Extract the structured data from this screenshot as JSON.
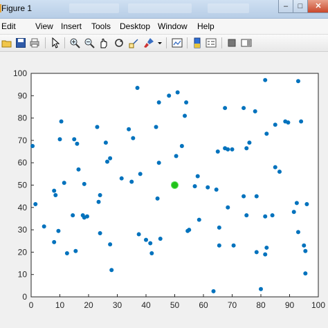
{
  "window": {
    "title": "Figure 1",
    "controls": {
      "minimize": "–",
      "maximize": "□",
      "close": "✕"
    }
  },
  "menu": {
    "items": [
      "Edit",
      "View",
      "Insert",
      "Tools",
      "Desktop",
      "Window",
      "Help"
    ]
  },
  "toolbar": {
    "icons": [
      "open-icon",
      "save-icon",
      "print-icon",
      "pointer-icon",
      "zoom-in-icon",
      "zoom-out-icon",
      "pan-icon",
      "rotate-icon",
      "data-cursor-icon",
      "brush-icon",
      "link-icon",
      "colorbar-icon",
      "legend-icon",
      "hide-plot-tools-icon",
      "show-plot-tools-icon"
    ]
  },
  "colors": {
    "marker": "#0072bd",
    "highlight": "#21c21b",
    "highlight_edge": "#5fe05a"
  },
  "chart_data": {
    "type": "scatter",
    "xlim": [
      0,
      100
    ],
    "ylim": [
      0,
      100
    ],
    "xticks": [
      0,
      10,
      20,
      30,
      40,
      50,
      60,
      70,
      80,
      90,
      100
    ],
    "yticks": [
      0,
      10,
      20,
      30,
      40,
      50,
      60,
      70,
      80,
      90,
      100
    ],
    "grid": false,
    "series": [
      {
        "points": [
          [
            0.5,
            67.5
          ],
          [
            1.5,
            41.5
          ],
          [
            4.5,
            31.5
          ],
          [
            8,
            24.5
          ],
          [
            8,
            47.5
          ],
          [
            8.5,
            45.5
          ],
          [
            9.5,
            29.5
          ],
          [
            10,
            70.5
          ],
          [
            10.5,
            78.5
          ],
          [
            11.5,
            51
          ],
          [
            12.5,
            19.5
          ],
          [
            14.5,
            36.5
          ],
          [
            15,
            70.5
          ],
          [
            15.5,
            20.5
          ],
          [
            16,
            68.5
          ],
          [
            16.5,
            57
          ],
          [
            18,
            36.5
          ],
          [
            18.5,
            50.5
          ],
          [
            18.5,
            35.5
          ],
          [
            19.5,
            36
          ],
          [
            23,
            76
          ],
          [
            23.5,
            42.5
          ],
          [
            24,
            28.5
          ],
          [
            24,
            45.5
          ],
          [
            26,
            69
          ],
          [
            26.5,
            60.5
          ],
          [
            27.5,
            23.5
          ],
          [
            27.5,
            62
          ],
          [
            28,
            12
          ],
          [
            31.5,
            53
          ],
          [
            34,
            75
          ],
          [
            35,
            51.5
          ],
          [
            35.5,
            71
          ],
          [
            37,
            93.5
          ],
          [
            37.5,
            28
          ],
          [
            38,
            55
          ],
          [
            40,
            25.5
          ],
          [
            41.5,
            24
          ],
          [
            42,
            19.5
          ],
          [
            43.5,
            76
          ],
          [
            44,
            44
          ],
          [
            45,
            26
          ],
          [
            44.5,
            87
          ],
          [
            44.5,
            60
          ],
          [
            48,
            90
          ],
          [
            49.5,
            50.5
          ],
          [
            50.5,
            63
          ],
          [
            51,
            91.5
          ],
          [
            52.5,
            67.5
          ],
          [
            53.5,
            81
          ],
          [
            54,
            87
          ],
          [
            54.5,
            29.5
          ],
          [
            55,
            30
          ],
          [
            57,
            49.5
          ],
          [
            58,
            54
          ],
          [
            58.5,
            34.5
          ],
          [
            61.5,
            49
          ],
          [
            63.5,
            2.5
          ],
          [
            64.5,
            48
          ],
          [
            65,
            65
          ],
          [
            65.5,
            31
          ],
          [
            65.5,
            23
          ],
          [
            67.5,
            84.5
          ],
          [
            67.5,
            66.5
          ],
          [
            68.5,
            66
          ],
          [
            68.5,
            40
          ],
          [
            70,
            66
          ],
          [
            70.5,
            23
          ],
          [
            74,
            45
          ],
          [
            74,
            84.5
          ],
          [
            75,
            66.5
          ],
          [
            75,
            36.5
          ],
          [
            76,
            69
          ],
          [
            78,
            83
          ],
          [
            78.5,
            45
          ],
          [
            78.5,
            20
          ],
          [
            80,
            3.5
          ],
          [
            81.5,
            36
          ],
          [
            81.5,
            19
          ],
          [
            81.5,
            97
          ],
          [
            82,
            22
          ],
          [
            82,
            73
          ],
          [
            84,
            36.5
          ],
          [
            85,
            58
          ],
          [
            85,
            77
          ],
          [
            86.5,
            56
          ],
          [
            88.5,
            78.5
          ],
          [
            89.5,
            78
          ],
          [
            91.5,
            38
          ],
          [
            92.5,
            42
          ],
          [
            93,
            96.5
          ],
          [
            93,
            29
          ],
          [
            94,
            78.5
          ],
          [
            95,
            23
          ],
          [
            95.5,
            20.5
          ],
          [
            95.5,
            10.5
          ],
          [
            96,
            41.5
          ]
        ]
      },
      {
        "points": [
          [
            50,
            50
          ]
        ]
      }
    ]
  }
}
